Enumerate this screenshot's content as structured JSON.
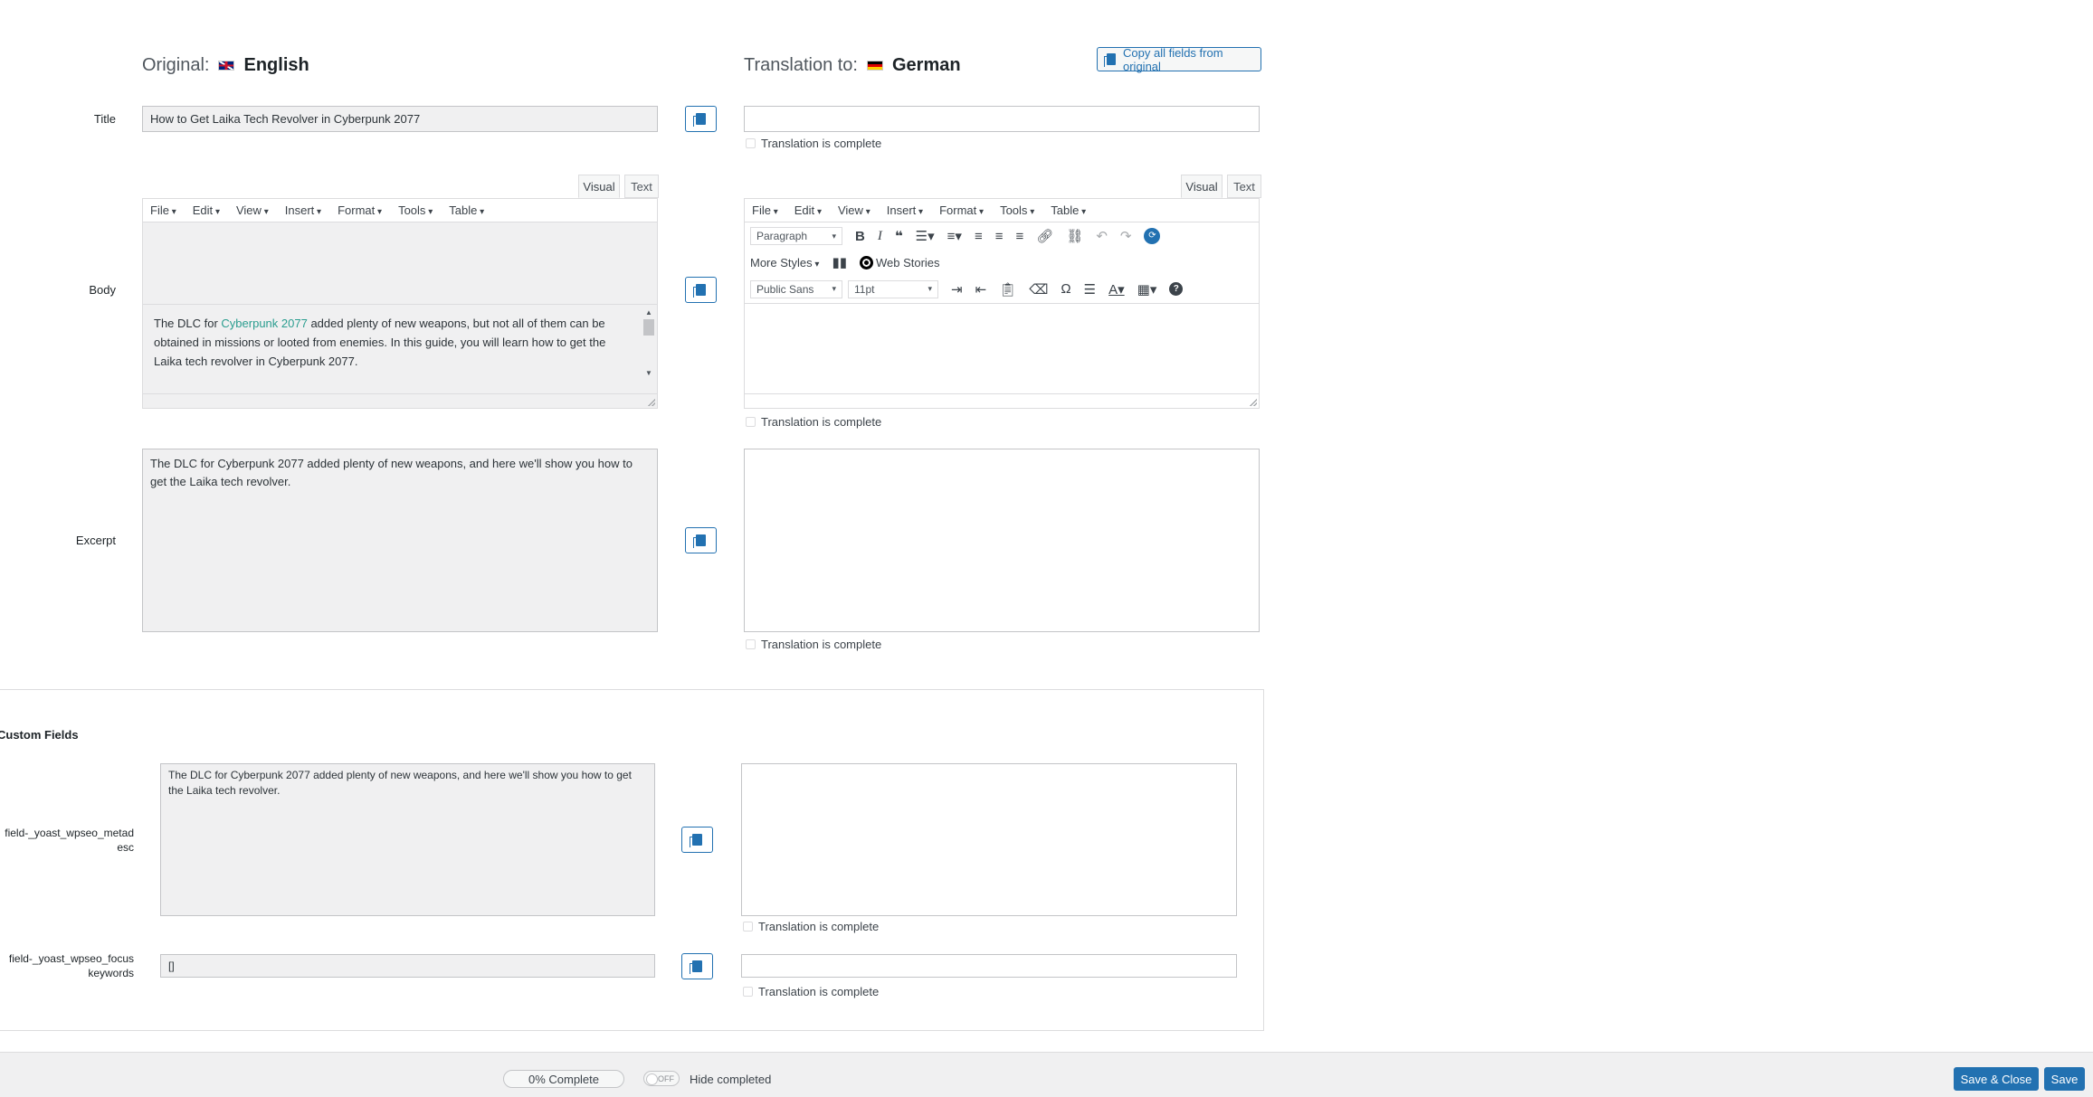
{
  "header": {
    "original_prefix": "Original:",
    "original_lang": "English",
    "translation_prefix": "Translation to:",
    "translation_lang": "German",
    "copy_all_label": "Copy all fields from original"
  },
  "fields": {
    "title": {
      "label": "Title",
      "original_value": "How to Get Laika Tech Revolver in Cyberpunk 2077",
      "translation_value": ""
    },
    "body": {
      "label": "Body",
      "original_text_before_link": "The DLC for ",
      "original_link": "Cyberpunk 2077",
      "original_text_after_link": " added plenty of new weapons, but not all of them can be obtained in missions or looted from enemies. In this guide, you will learn how to get the Laika tech revolver in Cyberpunk 2077."
    },
    "excerpt": {
      "label": "Excerpt",
      "original_value": "The DLC for Cyberpunk 2077 added plenty of new weapons, and here we'll show you how to get the Laika tech revolver.",
      "translation_value": ""
    }
  },
  "editor": {
    "tabs": {
      "visual": "Visual",
      "text": "Text"
    },
    "menu": [
      "File",
      "Edit",
      "View",
      "Insert",
      "Format",
      "Tools",
      "Table"
    ],
    "format_select": "Paragraph",
    "more_styles": "More Styles",
    "web_stories": "Web Stories",
    "font_family": "Public Sans",
    "font_size": "11pt"
  },
  "complete_label": "Translation is complete",
  "custom_fields": {
    "title": "Custom Fields",
    "metadesc": {
      "label": "field-_yoast_wpseo_metadesc",
      "original_value": "The DLC for Cyberpunk 2077 added plenty of new weapons, and here we'll show you how to get the Laika tech revolver.",
      "translation_value": ""
    },
    "focuskw": {
      "label": "field-_yoast_wpseo_focuskeywords",
      "original_value": "[]",
      "translation_value": ""
    }
  },
  "footer": {
    "progress_label": "0% Complete",
    "toggle_state": "OFF",
    "hide_completed": "Hide completed",
    "save_close": "Save & Close",
    "save": "Save"
  },
  "colors": {
    "primary": "#2271b1",
    "link": "#2a9d8f",
    "panel": "#f0f0f1"
  }
}
